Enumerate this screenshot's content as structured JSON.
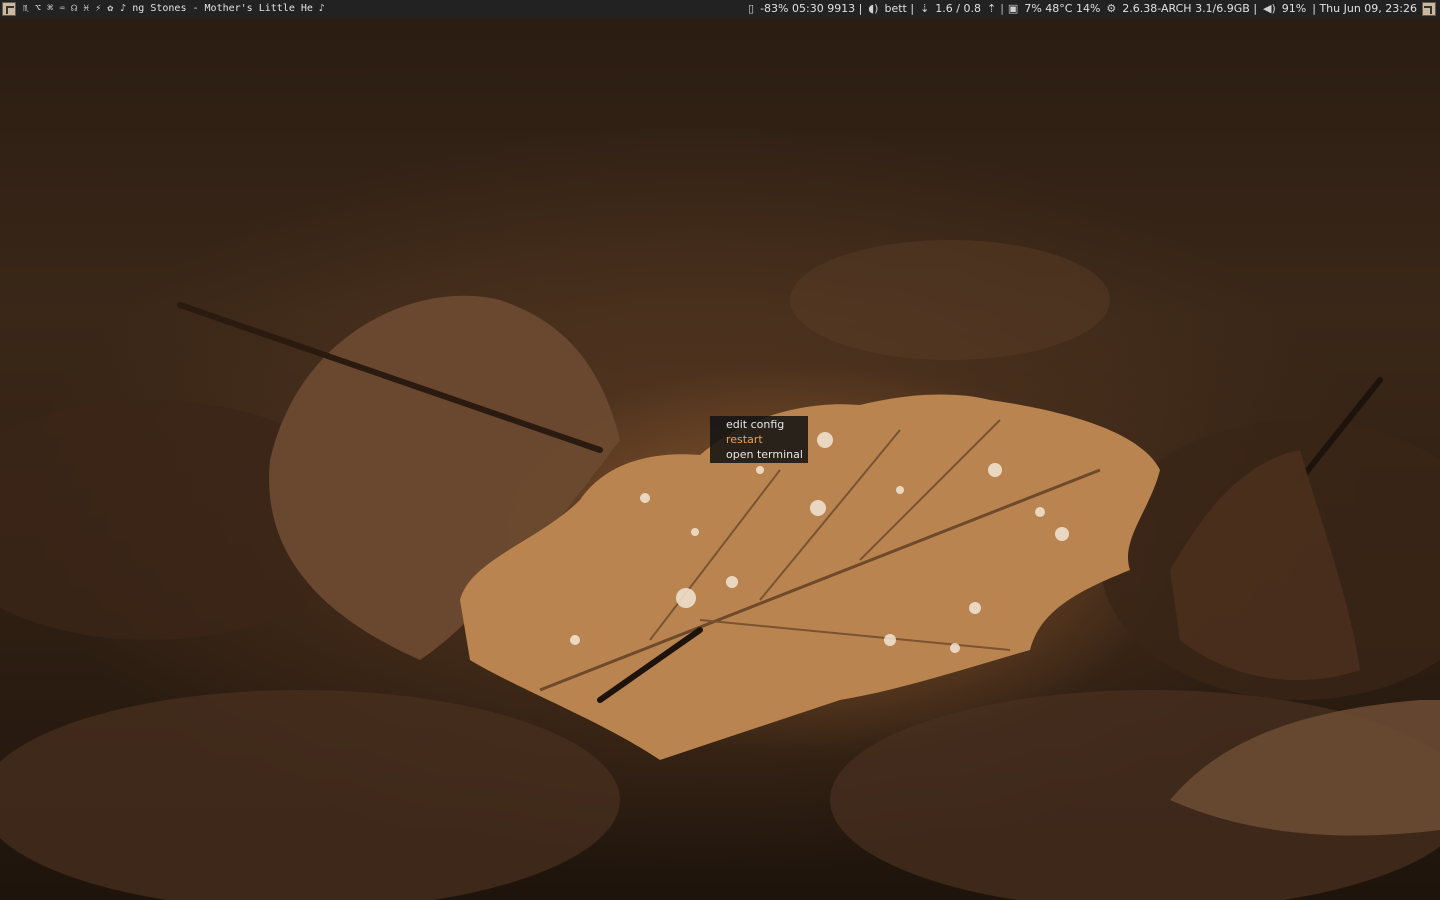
{
  "topbar": {
    "tags": [
      "♏",
      "⌥",
      "⌘",
      "♒",
      "☊",
      "♓",
      "⚡",
      "✿"
    ],
    "now_playing": "♪ ng Stones - Mother's Little He ♪",
    "battery": "-83% 05:30 9913 |",
    "wifi": "bett |",
    "network": "1.6 / 0.8",
    "cpu": "7% 48°C 14%",
    "system": "2.6.38-ARCH 3.1/6.9GB |",
    "volume": "91%",
    "datetime": "| Thu Jun 09, 23:26"
  },
  "context_menu": {
    "items": [
      "edit config",
      "restart",
      "open terminal"
    ],
    "active_index": 1
  },
  "colors": {
    "bar_bg": "#222222",
    "menu_active": "#e8a256"
  },
  "icons": [
    "layout-icon",
    "battery-icon",
    "wifi-icon",
    "download-icon",
    "upload-icon",
    "cpu-icon",
    "settings-icon",
    "volume-icon"
  ]
}
